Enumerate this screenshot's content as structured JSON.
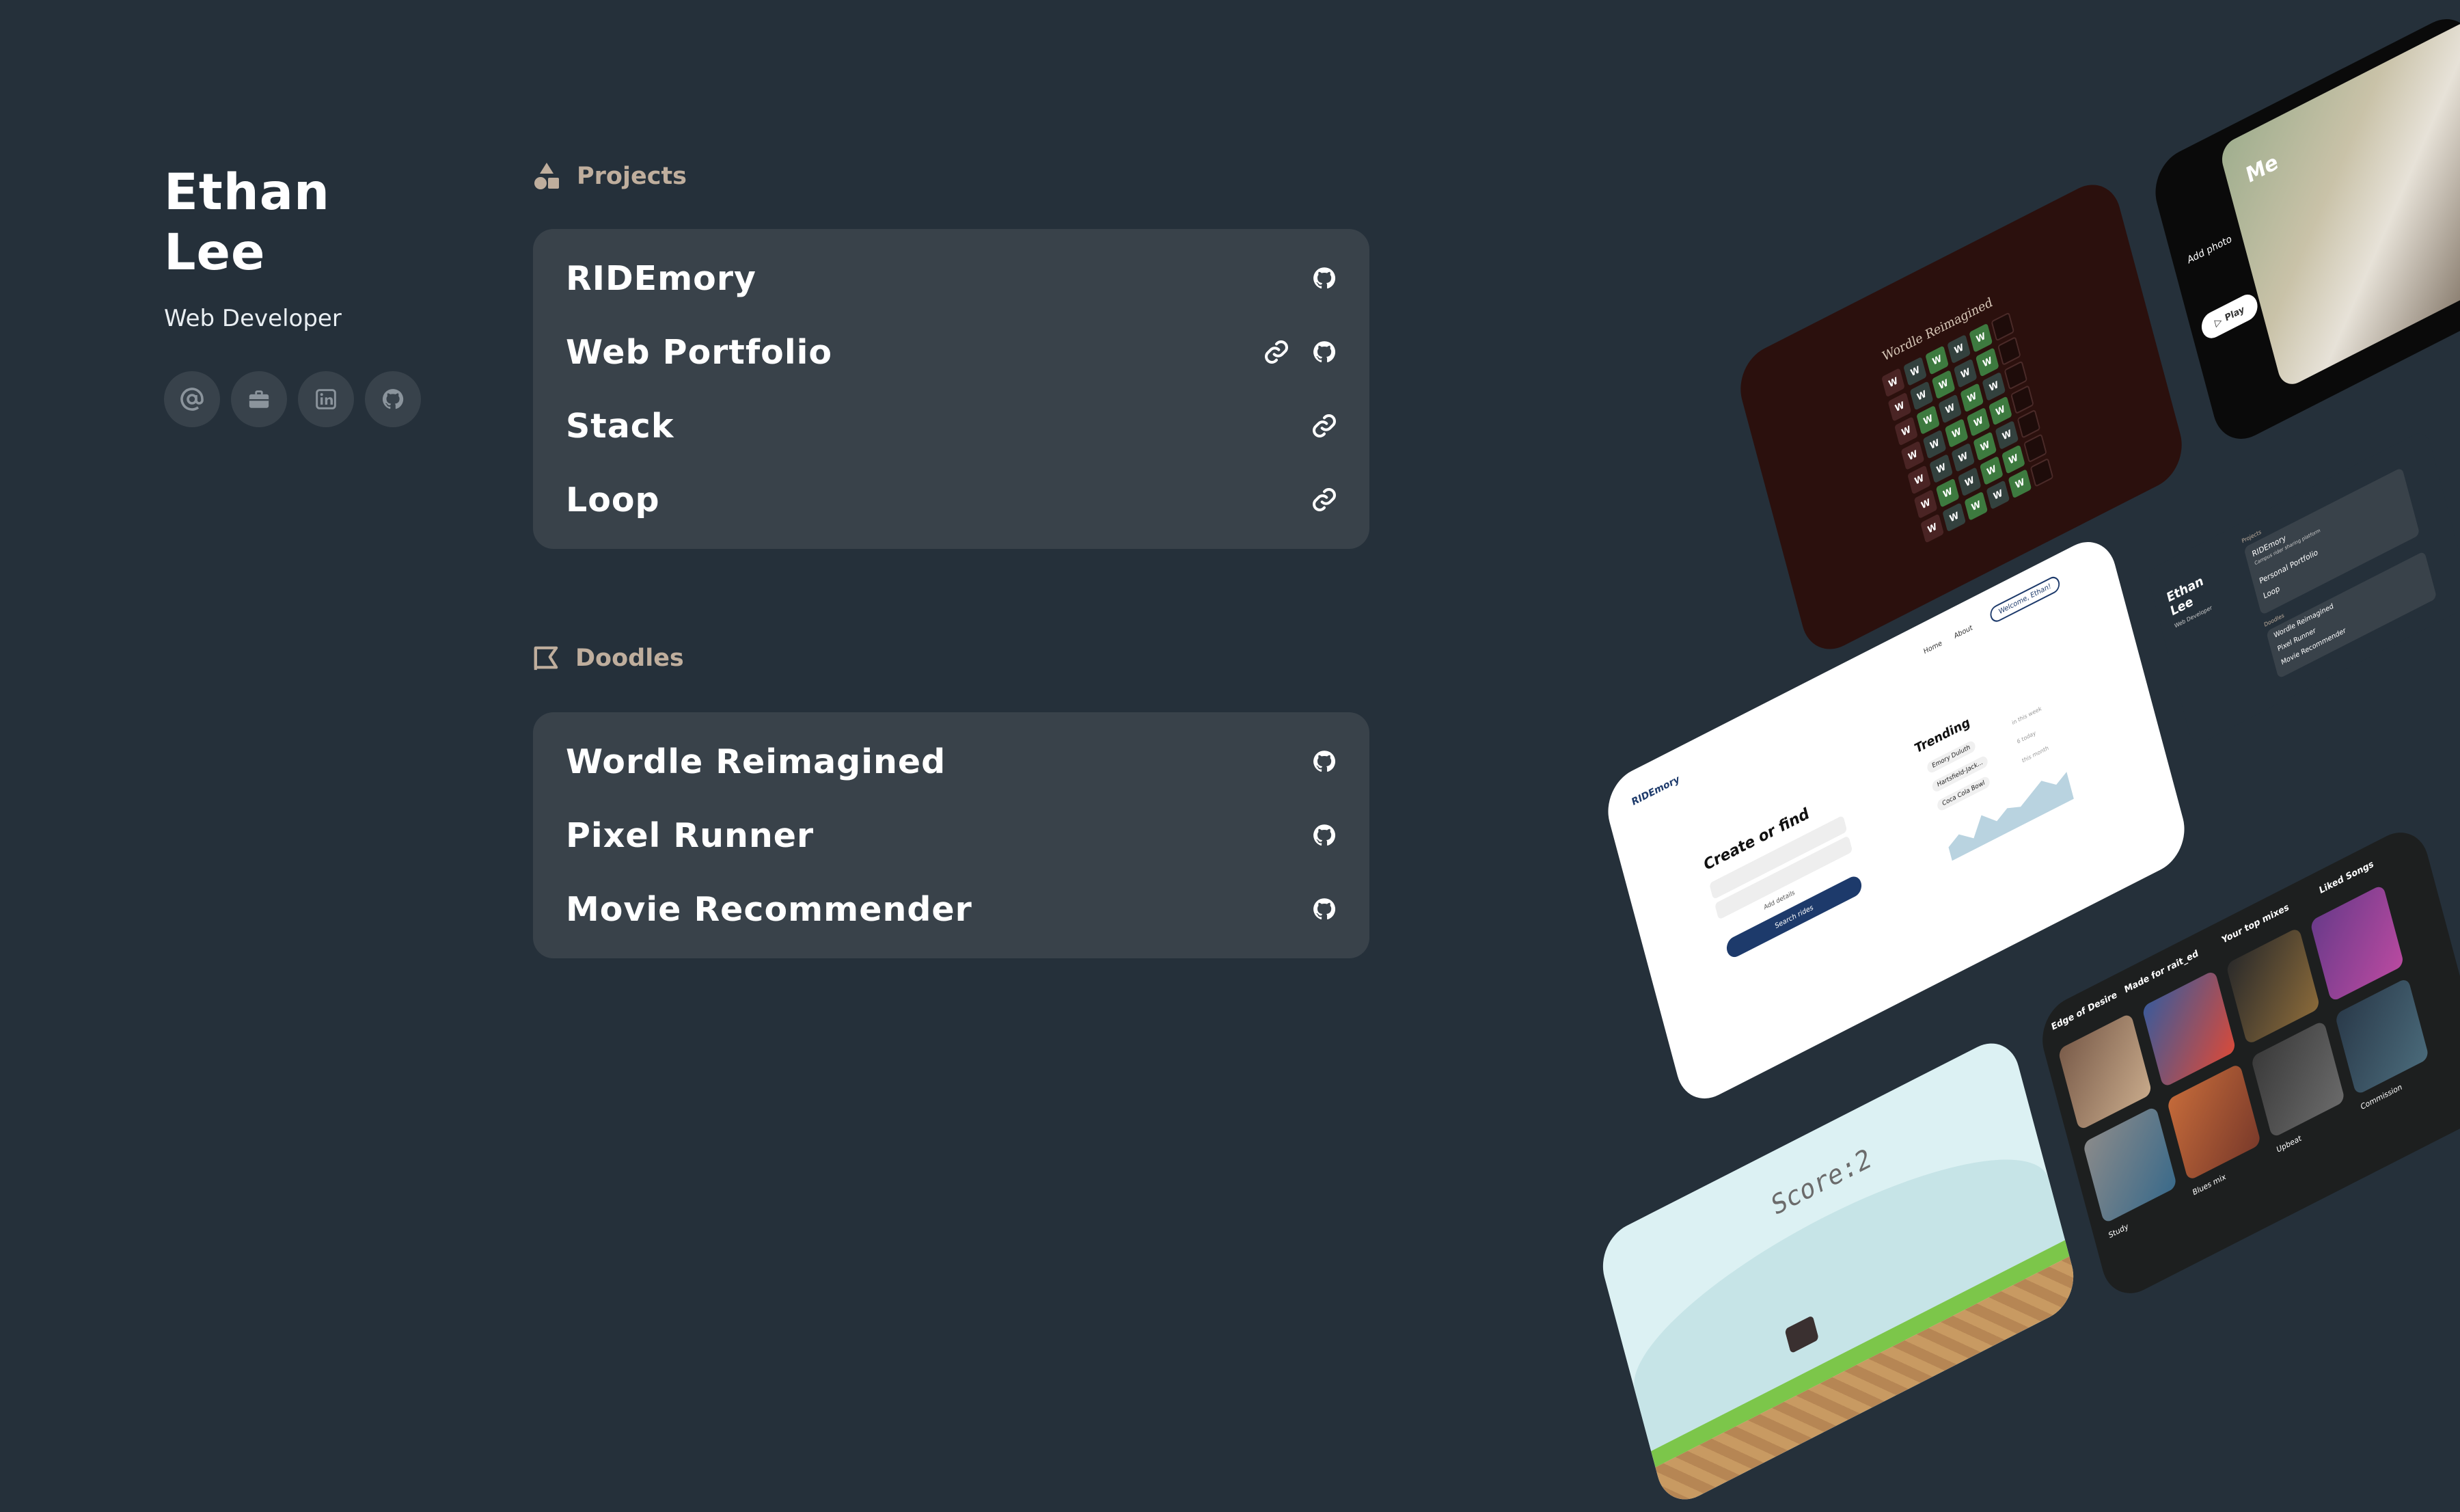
{
  "profile": {
    "name_line1": "Ethan",
    "name_line2": "Lee",
    "role": "Web Developer",
    "socials": [
      {
        "icon": "at-icon"
      },
      {
        "icon": "briefcase-icon"
      },
      {
        "icon": "linkedin-icon"
      },
      {
        "icon": "github-icon"
      }
    ]
  },
  "projects": {
    "heading": "Projects",
    "icon": "shapes-icon",
    "items": [
      {
        "title": "RIDEmory",
        "links": [
          "github-icon"
        ]
      },
      {
        "title": "Web Portfolio",
        "links": [
          "link-icon",
          "github-icon"
        ]
      },
      {
        "title": "Stack",
        "links": [
          "link-icon"
        ]
      },
      {
        "title": "Loop",
        "links": [
          "link-icon"
        ]
      }
    ]
  },
  "doodles": {
    "heading": "Doodles",
    "icon": "doodle-icon",
    "items": [
      {
        "title": "Wordle Reimagined",
        "links": [
          "github-icon"
        ]
      },
      {
        "title": "Pixel Runner",
        "links": [
          "github-icon"
        ]
      },
      {
        "title": "Movie Recommender",
        "links": [
          "github-icon"
        ]
      }
    ]
  },
  "previews": {
    "wordle": {
      "title": "Wordle Reimagined",
      "tile": "W"
    },
    "ridemory": {
      "brand": "RIDEmory",
      "nav": [
        "Home",
        "About"
      ],
      "welcome": "Welcome, Ethan!",
      "create": "Create or find",
      "add_details": "Add details",
      "search": "Search rides",
      "trending": "Trending",
      "routes": [
        "Emory Duluth",
        "Hartsfield-Jack...",
        "Coca Cola Bowl"
      ],
      "route_times": [
        "in this week",
        "6 today",
        "this month"
      ]
    },
    "pixel_runner": {
      "score": "Score:2"
    },
    "loop": {
      "me": "Me",
      "add_photo": "Add photo",
      "play": "Play"
    },
    "mini_portfolio": {
      "name_line1": "Ethan",
      "name_line2": "Lee",
      "role": "Web Developer",
      "projects_heading": "Projects",
      "project_title": "RIDEmory",
      "project_desc": "Campus rider sharing platform",
      "items": [
        "Personal Portfolio",
        "Loop"
      ],
      "doodles_heading": "Doodles",
      "doodles": [
        "Wordle Reimagined",
        "Pixel Runner",
        "Movie Recommender"
      ]
    },
    "music": {
      "sections": [
        "Edge of Desire",
        "Made for rait_ed",
        "Your top mixes",
        "Liked Songs"
      ],
      "tiles": [
        "Study",
        "Blues mix",
        "Upbeat",
        "Commission"
      ]
    }
  }
}
